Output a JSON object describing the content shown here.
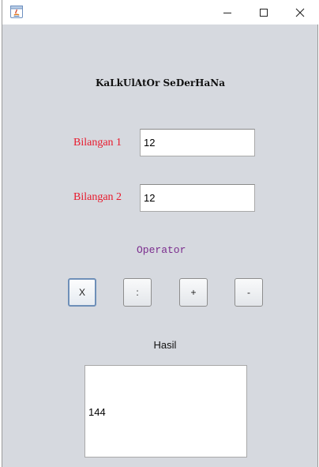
{
  "window": {
    "icon": "java-icon",
    "controls": {
      "minimize": "minimize-icon",
      "maximize": "maximize-icon",
      "close": "close-icon"
    }
  },
  "heading": "KaLkUlAtOr SeDerHaNa",
  "inputs": {
    "bilangan1": {
      "label": "Bilangan 1",
      "value": "12"
    },
    "bilangan2": {
      "label": "Bilangan 2",
      "value": "12"
    }
  },
  "operator": {
    "label": "Operator",
    "buttons": [
      "X",
      ":",
      "+",
      "-"
    ],
    "focused": "X"
  },
  "result": {
    "label": "Hasil",
    "value": "144"
  },
  "colors": {
    "panel_background": "#d6d9df",
    "label_red": "#e8192c",
    "operator_purple": "#7b2d8e"
  }
}
